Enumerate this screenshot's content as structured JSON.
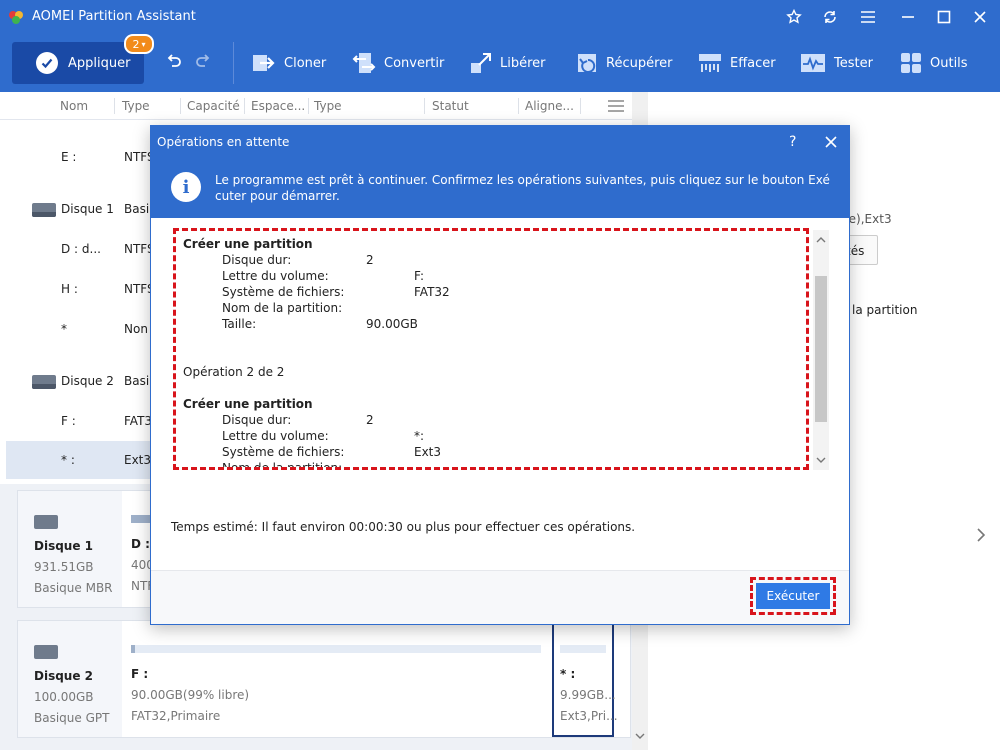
{
  "app": {
    "title": "AOMEI Partition Assistant",
    "accent": "#2f6ccd"
  },
  "toolbar": {
    "apply_label": "Appliquer",
    "pending_count": "2",
    "tools": [
      {
        "label": "Cloner",
        "icon": "clone-icon"
      },
      {
        "label": "Convertir",
        "icon": "convert-icon"
      },
      {
        "label": "Libérer",
        "icon": "free-up-icon"
      },
      {
        "label": "Récupérer",
        "icon": "recover-icon"
      },
      {
        "label": "Effacer",
        "icon": "wipe-icon"
      },
      {
        "label": "Tester",
        "icon": "test-icon"
      },
      {
        "label": "Outils",
        "icon": "tools-icon"
      }
    ]
  },
  "columns": [
    "Nom",
    "Type",
    "Capacité",
    "Espace...",
    "Type",
    "Statut",
    "Aligne..."
  ],
  "rows": [
    {
      "name": "E :",
      "type": "NTFS"
    },
    {
      "name": "Disque 1",
      "type": "Basi"
    },
    {
      "name": "D : d...",
      "type": "NTFS"
    },
    {
      "name": "H :",
      "type": "NTFS"
    },
    {
      "name": "*",
      "type": "Non"
    },
    {
      "name": "Disque 2",
      "type": "Basi"
    },
    {
      "name": "F :",
      "type": "FAT3"
    },
    {
      "name": "* :",
      "type": "Ext3"
    }
  ],
  "cards": [
    {
      "name": "Disque 1",
      "size": "931.51GB",
      "kind": "Basique MBR",
      "p1_label": "D :",
      "p1_size": "400",
      "p1_fs": "NTF"
    },
    {
      "name": "Disque 2",
      "size": "100.00GB",
      "kind": "Basique GPT",
      "p1_label": "F :",
      "p1_size": "90.00GB(99% libre)",
      "p1_fs": "FAT32,Primaire",
      "p2_label": "* :",
      "p2_size": "9.99GB...",
      "p2_fs": "Ext3,Pri..."
    }
  ],
  "right_panel": {
    "fs_fragment": "re),Ext3",
    "btn_fragment": "tés",
    "link_fragment": "la partition"
  },
  "dialog": {
    "title": "Opérations en attente",
    "info": "Le programme est prêt à continuer. Confirmez les opérations suivantes, puis cliquez sur le bouton Exé cuter pour démarrer.",
    "op1": {
      "title": "Créer une partition",
      "lines": [
        {
          "k": "Disque dur:",
          "v": "2"
        },
        {
          "k": "Lettre du volume:",
          "v": "F:"
        },
        {
          "k": "Système de fichiers:",
          "v": "FAT32"
        },
        {
          "k": "Nom de la partition:",
          "v": ""
        },
        {
          "k": "Taille:",
          "v": "90.00GB"
        }
      ]
    },
    "op2_heading": "Opération 2 de 2",
    "op2": {
      "title": "Créer une partition",
      "lines": [
        {
          "k": "Disque dur:",
          "v": "2"
        },
        {
          "k": "Lettre du volume:",
          "v": "*:"
        },
        {
          "k": "Système de fichiers:",
          "v": "Ext3"
        },
        {
          "k": "Nom de la partition:",
          "v": ""
        }
      ]
    },
    "estimate": "Temps estimé: Il faut environ 00:00:30 ou plus pour effectuer ces opérations.",
    "execute_label": "Exécuter"
  }
}
